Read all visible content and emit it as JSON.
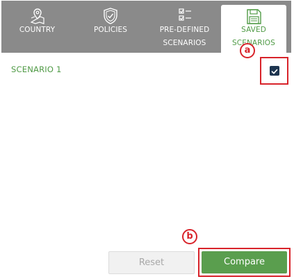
{
  "tabs": [
    {
      "label_line1": "COUNTRY",
      "label_line2": "",
      "icon": "map-pin-icon",
      "active": false
    },
    {
      "label_line1": "POLICIES",
      "label_line2": "",
      "icon": "shield-check-icon",
      "active": false
    },
    {
      "label_line1": "PRE-DEFINED",
      "label_line2": "SCENARIOS",
      "icon": "checklist-icon",
      "active": false
    },
    {
      "label_line1": "SAVED",
      "label_line2": "SCENARIOS",
      "icon": "save-disk-icon",
      "active": true
    }
  ],
  "scenarios": [
    {
      "name": "SCENARIO 1",
      "checked": true
    }
  ],
  "annotations": {
    "a": "a",
    "b": "b"
  },
  "buttons": {
    "reset": "Reset",
    "compare": "Compare"
  },
  "colors": {
    "tab_bar": "#8a8a8a",
    "accent_green": "#4f9a45",
    "compare_button": "#5a9e4e",
    "checkbox": "#1e3550",
    "highlight_red": "#d8232a"
  }
}
